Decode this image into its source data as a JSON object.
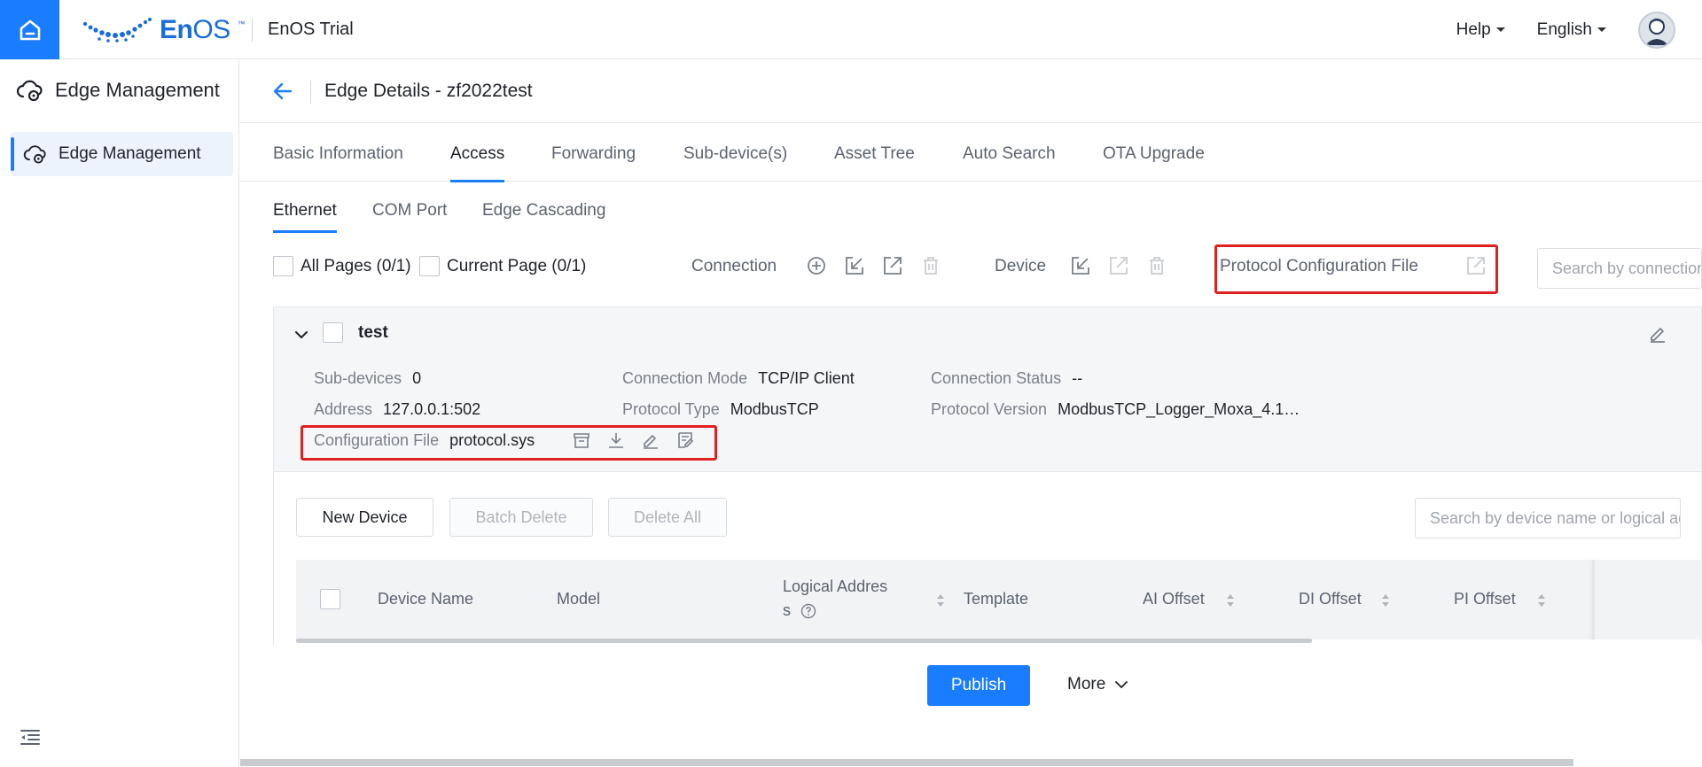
{
  "topbar": {
    "brand_en": "En",
    "brand_os": "OS",
    "brand_tm": "™",
    "app_title": "EnOS Trial",
    "help_label": "Help",
    "language_label": "English"
  },
  "sidebar": {
    "header": "Edge Management",
    "items": [
      {
        "label": "Edge Management"
      }
    ]
  },
  "page": {
    "title": "Edge Details - zf2022test"
  },
  "tabs": [
    {
      "label": "Basic Information"
    },
    {
      "label": "Access"
    },
    {
      "label": "Forwarding"
    },
    {
      "label": "Sub-device(s)"
    },
    {
      "label": "Asset Tree"
    },
    {
      "label": "Auto Search"
    },
    {
      "label": "OTA Upgrade"
    }
  ],
  "subtabs": [
    {
      "label": "Ethernet"
    },
    {
      "label": "COM Port"
    },
    {
      "label": "Edge Cascading"
    }
  ],
  "toolbar": {
    "all_pages": "All Pages (0/1)",
    "current_page": "Current Page (0/1)",
    "connection_label": "Connection",
    "device_label": "Device",
    "protocol_cfg_label": "Protocol  Configuration  File",
    "search_placeholder": "Search by connection"
  },
  "connection": {
    "name": "test",
    "sub_devices_label": "Sub-devices",
    "sub_devices_value": "0",
    "address_label": "Address",
    "address_value": "127.0.0.1:502",
    "config_file_label": "Configuration File",
    "config_file_value": "protocol.sys",
    "mode_label": "Connection Mode",
    "mode_value": "TCP/IP Client",
    "protocol_type_label": "Protocol Type",
    "protocol_type_value": "ModbusTCP",
    "status_label": "Connection Status",
    "status_value": "--",
    "protocol_version_label": "Protocol Version",
    "protocol_version_value": "ModbusTCP_Logger_Moxa_4.1…"
  },
  "devices": {
    "new_device": "New Device",
    "batch_delete": "Batch Delete",
    "delete_all": "Delete All",
    "search_placeholder": "Search by device name or logical address",
    "columns": {
      "device_name": "Device Name",
      "model": "Model",
      "logical_address_1": "Logical Addres",
      "logical_address_2": "s",
      "template": "Template",
      "ai_offset": "AI Offset",
      "di_offset": "DI Offset",
      "pi_offset": "PI Offset"
    }
  },
  "footer": {
    "publish": "Publish",
    "more": "More"
  },
  "colors": {
    "primary": "#1a7cff",
    "highlight_box": "#e02020"
  }
}
